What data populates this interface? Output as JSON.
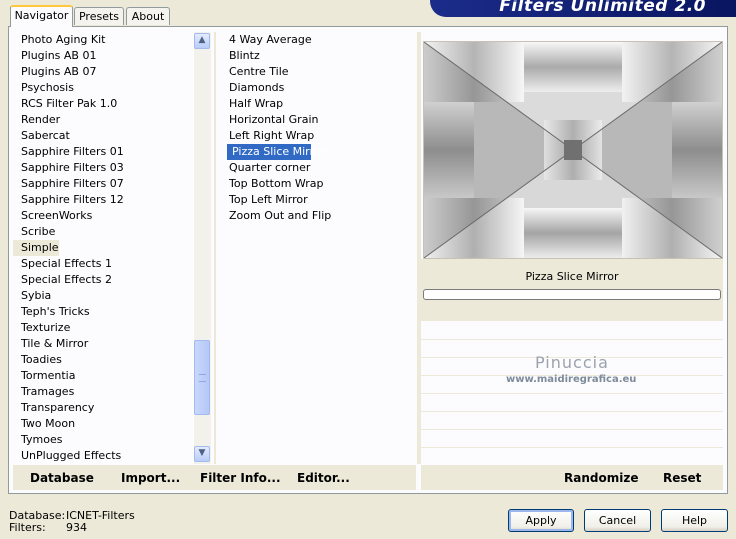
{
  "app": {
    "title": "Filters Unlimited 2.0"
  },
  "tabs": [
    {
      "label": "Navigator"
    },
    {
      "label": "Presets"
    },
    {
      "label": "About"
    }
  ],
  "categories": [
    "Photo Aging Kit",
    "Plugins AB 01",
    "Plugins AB 07",
    "Psychosis",
    "RCS Filter Pak 1.0",
    "Render",
    "Sabercat",
    "Sapphire Filters 01",
    "Sapphire Filters 03",
    "Sapphire Filters 07",
    "Sapphire Filters 12",
    "ScreenWorks",
    "Scribe",
    "Simple",
    "Special Effects 1",
    "Special Effects 2",
    "Sybia",
    "Teph's Tricks",
    "Texturize",
    "Tile & Mirror",
    "Toadies",
    "Tormentia",
    "Tramages",
    "Transparency",
    "Two Moon",
    "Tymoes",
    "UnPlugged Effects"
  ],
  "selected_category": "Simple",
  "filters": [
    "4 Way Average",
    "Blintz",
    "Centre Tile",
    "Diamonds",
    "Half Wrap",
    "Horizontal Grain",
    "Left Right Wrap",
    "Pizza Slice Mirror",
    "Quarter corner",
    "Top Bottom Wrap",
    "Top Left Mirror",
    "Zoom Out and Flip"
  ],
  "selected_filter": "Pizza Slice Mirror",
  "left_buttons": {
    "database": "Database",
    "import": "Import...",
    "filter_info": "Filter Info...",
    "editor": "Editor..."
  },
  "right_buttons": {
    "randomize": "Randomize",
    "reset": "Reset"
  },
  "preview": {
    "filter_name": "Pizza Slice Mirror"
  },
  "watermark": {
    "name": "Pinuccia",
    "url": "www.maidiregrafica.eu"
  },
  "status": {
    "database_label": "Database:",
    "database_value": "ICNET-Filters",
    "filters_label": "Filters:",
    "filters_value": "934"
  },
  "dialog_buttons": {
    "apply": "Apply",
    "cancel": "Cancel",
    "help": "Help"
  },
  "colors": {
    "selection": "#316ac5",
    "banner": "#1b2c8a",
    "face": "#ece9d8"
  }
}
